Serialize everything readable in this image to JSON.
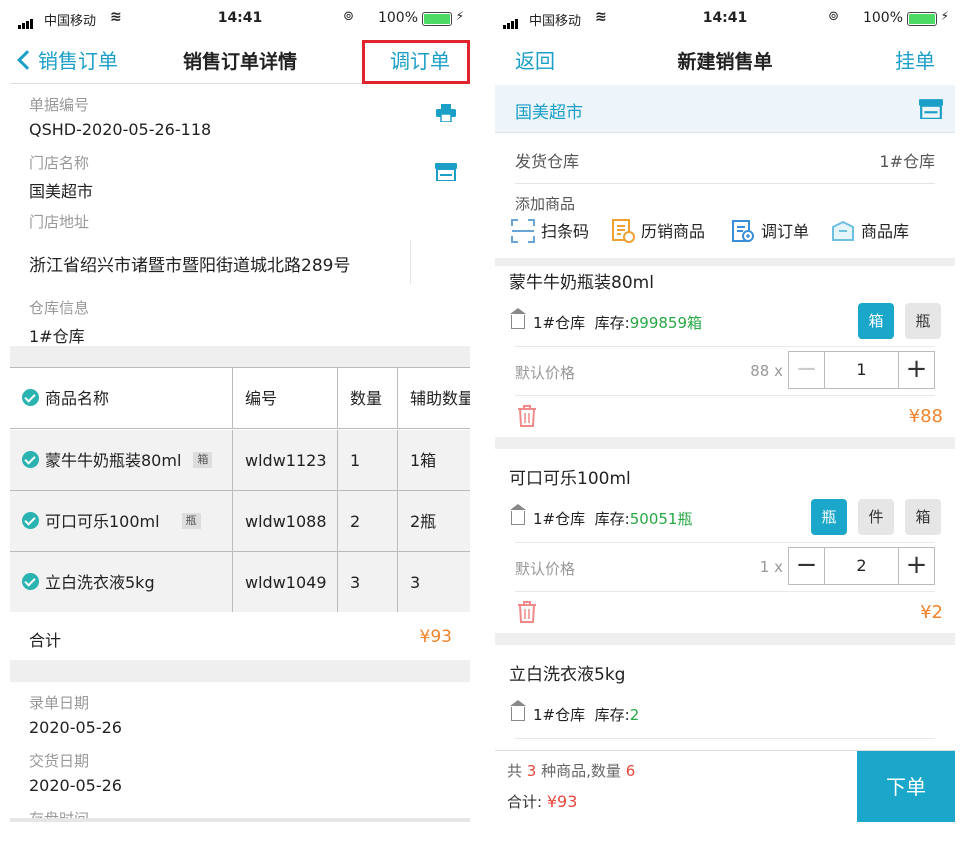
{
  "left": {
    "status": {
      "carrier": "中国移动",
      "time": "14:41",
      "battery_pct": "100%"
    },
    "nav": {
      "back_label": "销售订单",
      "title": "销售订单详情",
      "action_label": "调订单"
    },
    "fields": {
      "doc_no_label": "单据编号",
      "doc_no": "QSHD-2020-05-26-118",
      "store_label": "门店名称",
      "store": "国美超市",
      "address_label": "门店地址",
      "address": "浙江省绍兴市诸暨市暨阳街道城北路289号",
      "warehouse_label": "仓库信息",
      "warehouse": "1#仓库"
    },
    "table": {
      "headers": [
        "商品名称",
        "编号",
        "数量",
        "辅助数量"
      ],
      "rows": [
        {
          "name": "蒙牛牛奶瓶装80ml",
          "unit": "箱",
          "code": "wldw1123",
          "qty": "1",
          "aux": "1箱"
        },
        {
          "name": "可口可乐100ml",
          "unit": "瓶",
          "code": "wldw1088",
          "qty": "2",
          "aux": "2瓶"
        },
        {
          "name": "立白洗衣液5kg",
          "unit": "",
          "code": "wldw1049",
          "qty": "3",
          "aux": "3"
        }
      ]
    },
    "total_label": "合计",
    "total": "¥93",
    "dates": {
      "entry_label": "录单日期",
      "entry": "2020-05-26",
      "delivery_label": "交货日期",
      "delivery": "2020-05-26",
      "stocktake_label": "存盘时间"
    }
  },
  "right": {
    "status": {
      "carrier": "中国移动",
      "time": "14:41",
      "battery_pct": "100%"
    },
    "nav": {
      "back_label": "返回",
      "title": "新建销售单",
      "action_label": "挂单"
    },
    "store": "国美超市",
    "ship_wh_label": "发货仓库",
    "ship_wh": "1#仓库",
    "add_label": "添加商品",
    "tools": [
      "扫条码",
      "历销商品",
      "调订单",
      "商品库"
    ],
    "products": [
      {
        "name": "蒙牛牛奶瓶装80ml",
        "warehouse": "1#仓库",
        "stock_label": "库存:",
        "stock": "999859箱",
        "units": [
          "箱",
          "瓶"
        ],
        "active_unit": 0,
        "price_label": "默认价格",
        "price": "88 x",
        "qty": "1",
        "line_total": "¥88"
      },
      {
        "name": "可口可乐100ml",
        "warehouse": "1#仓库",
        "stock_label": "库存:",
        "stock": "50051瓶",
        "units": [
          "瓶",
          "件",
          "箱"
        ],
        "active_unit": 0,
        "price_label": "默认价格",
        "price": "1 x",
        "qty": "2",
        "line_total": "¥2"
      },
      {
        "name": "立白洗衣液5kg",
        "warehouse": "1#仓库",
        "stock_label": "库存:",
        "stock": "2"
      }
    ],
    "footer": {
      "summary_prefix": "共",
      "kinds": "3",
      "summary_mid": "种商品,数量",
      "count": "6",
      "total_label": "合计:",
      "total": "¥93",
      "submit_label": "下单"
    },
    "colors": {
      "accent": "#1aa7c9",
      "price": "#f0842c",
      "highlight": "#e8483d",
      "stock": "#28a745"
    }
  }
}
